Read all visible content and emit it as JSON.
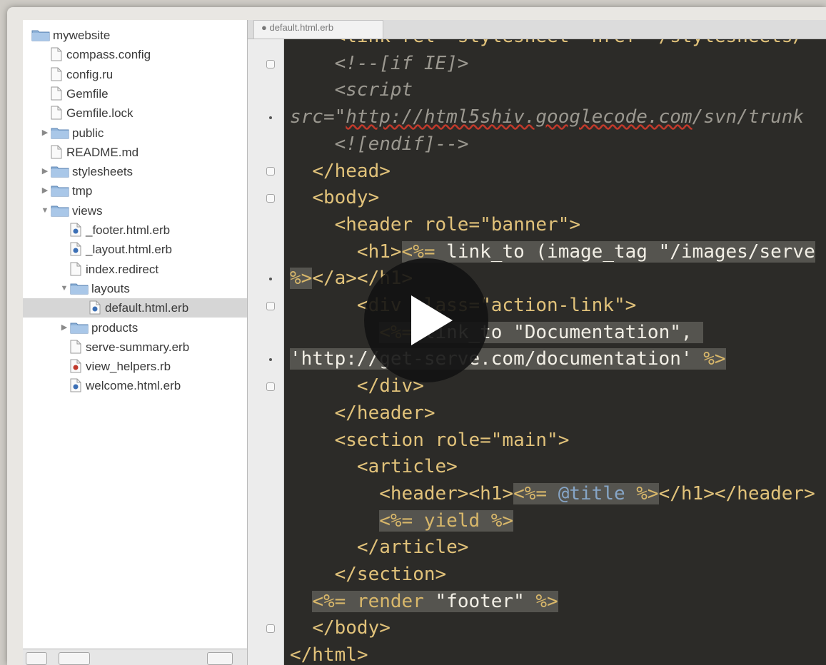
{
  "editor_tab": {
    "label": "default.html.erb"
  },
  "tree": [
    {
      "label": "mywebsite",
      "type": "folder",
      "indent": 0,
      "disclosure": "",
      "selected": false
    },
    {
      "label": "compass.config",
      "type": "file",
      "indent": 1,
      "disclosure": "",
      "selected": false
    },
    {
      "label": "config.ru",
      "type": "file",
      "indent": 1,
      "disclosure": "",
      "selected": false
    },
    {
      "label": "Gemfile",
      "type": "file",
      "indent": 1,
      "disclosure": "",
      "selected": false
    },
    {
      "label": "Gemfile.lock",
      "type": "file",
      "indent": 1,
      "disclosure": "",
      "selected": false
    },
    {
      "label": "public",
      "type": "folder",
      "indent": 1,
      "disclosure": "▶",
      "selected": false
    },
    {
      "label": "README.md",
      "type": "file",
      "indent": 1,
      "disclosure": "",
      "selected": false
    },
    {
      "label": "stylesheets",
      "type": "folder",
      "indent": 1,
      "disclosure": "▶",
      "selected": false
    },
    {
      "label": "tmp",
      "type": "folder",
      "indent": 1,
      "disclosure": "▶",
      "selected": false
    },
    {
      "label": "views",
      "type": "folder",
      "indent": 1,
      "disclosure": "▼",
      "selected": false
    },
    {
      "label": "_footer.html.erb",
      "type": "erb",
      "indent": 2,
      "disclosure": "",
      "selected": false
    },
    {
      "label": "_layout.html.erb",
      "type": "erb",
      "indent": 2,
      "disclosure": "",
      "selected": false
    },
    {
      "label": "index.redirect",
      "type": "file",
      "indent": 2,
      "disclosure": "",
      "selected": false
    },
    {
      "label": "layouts",
      "type": "folder",
      "indent": 2,
      "disclosure": "▼",
      "selected": false
    },
    {
      "label": "default.html.erb",
      "type": "erb",
      "indent": 3,
      "disclosure": "",
      "selected": true
    },
    {
      "label": "products",
      "type": "folder",
      "indent": 2,
      "disclosure": "▶",
      "selected": false
    },
    {
      "label": "serve-summary.erb",
      "type": "file",
      "indent": 2,
      "disclosure": "",
      "selected": false
    },
    {
      "label": "view_helpers.rb",
      "type": "ruby",
      "indent": 2,
      "disclosure": "",
      "selected": false
    },
    {
      "label": "welcome.html.erb",
      "type": "erb",
      "indent": 2,
      "disclosure": "",
      "selected": false
    }
  ],
  "code_lines": [
    {
      "i": "    ",
      "seg": [
        [
          "t",
          "<link rel=\"stylesheet\" href=\"/stylesheets/"
        ]
      ]
    },
    {
      "i": "    ",
      "seg": [
        [
          "c",
          "<!--[if IE]>"
        ]
      ]
    },
    {
      "i": "    ",
      "seg": [
        [
          "c",
          "<script"
        ]
      ]
    },
    {
      "i": "",
      "seg": [
        [
          "c",
          "src=\""
        ],
        [
          "cs",
          "http://html5shiv.googlecode.com"
        ],
        [
          "c",
          "/svn/trunk"
        ]
      ]
    },
    {
      "i": "    ",
      "seg": [
        [
          "c",
          "<![endif]-->"
        ]
      ]
    },
    {
      "i": "  ",
      "seg": [
        [
          "t",
          "</head>"
        ]
      ]
    },
    {
      "i": "  ",
      "seg": [
        [
          "t",
          "<body>"
        ]
      ]
    },
    {
      "i": "    ",
      "seg": [
        [
          "t",
          "<header role=\"banner\">"
        ]
      ]
    },
    {
      "i": "      ",
      "seg": [
        [
          "t",
          "<h1>"
        ],
        [
          "ek",
          "<%= "
        ],
        [
          "e",
          "link_to (image_tag \"/images/serve"
        ]
      ]
    },
    {
      "i": "",
      "seg": [
        [
          "ek",
          "%>"
        ],
        [
          "t",
          "</a></h1>"
        ]
      ]
    },
    {
      "i": "      ",
      "seg": [
        [
          "t",
          "<div class=\"action-link\">"
        ]
      ]
    },
    {
      "i": "        ",
      "seg": [
        [
          "ek",
          "<%= "
        ],
        [
          "e",
          "link_to \"Documentation\", "
        ]
      ]
    },
    {
      "i": "",
      "seg": [
        [
          "e",
          "'http://get-serve.com/documentation' "
        ],
        [
          "ek",
          "%>"
        ]
      ]
    },
    {
      "i": "      ",
      "seg": [
        [
          "t",
          "</div>"
        ]
      ]
    },
    {
      "i": "    ",
      "seg": [
        [
          "t",
          "</header>"
        ]
      ]
    },
    {
      "i": "    ",
      "seg": [
        [
          "t",
          "<section role=\"main\">"
        ]
      ]
    },
    {
      "i": "      ",
      "seg": [
        [
          "t",
          "<article>"
        ]
      ]
    },
    {
      "i": "        ",
      "seg": [
        [
          "t",
          "<header><h1>"
        ],
        [
          "ek",
          "<%= "
        ],
        [
          "ev",
          "@title "
        ],
        [
          "ek",
          "%>"
        ],
        [
          "t",
          "</h1></header>"
        ]
      ]
    },
    {
      "i": "        ",
      "seg": [
        [
          "ek",
          "<%= "
        ],
        [
          "ey",
          "yield "
        ],
        [
          "ek",
          "%>"
        ]
      ]
    },
    {
      "i": "      ",
      "seg": [
        [
          "t",
          "</article>"
        ]
      ]
    },
    {
      "i": "    ",
      "seg": [
        [
          "t",
          "</section>"
        ]
      ]
    },
    {
      "i": "  ",
      "seg": [
        [
          "ek",
          "<%= "
        ],
        [
          "ey",
          "render "
        ],
        [
          "es",
          "\"footer\" "
        ],
        [
          "ek",
          "%>"
        ]
      ]
    },
    {
      "i": "  ",
      "seg": [
        [
          "t",
          "</body>"
        ]
      ]
    },
    {
      "i": "",
      "seg": [
        [
          "t",
          "</html>"
        ]
      ]
    }
  ],
  "gutter_marks": [
    {
      "line": 1,
      "kind": "fold"
    },
    {
      "line": 3,
      "kind": "dot"
    },
    {
      "line": 5,
      "kind": "fold"
    },
    {
      "line": 6,
      "kind": "fold"
    },
    {
      "line": 9,
      "kind": "dot"
    },
    {
      "line": 10,
      "kind": "fold"
    },
    {
      "line": 12,
      "kind": "dot"
    },
    {
      "line": 13,
      "kind": "fold"
    },
    {
      "line": 22,
      "kind": "fold"
    }
  ],
  "colors": {
    "tag": "#e1c27a",
    "string": "#c6c6c6",
    "comment": "#9b9890",
    "erb_bg": "#55544f",
    "ivar": "#86a5c6"
  },
  "icons": {
    "play": "play-icon",
    "folder": "folder-icon",
    "file": "file-icon",
    "erb": "erb-file-icon",
    "ruby": "ruby-file-icon"
  }
}
